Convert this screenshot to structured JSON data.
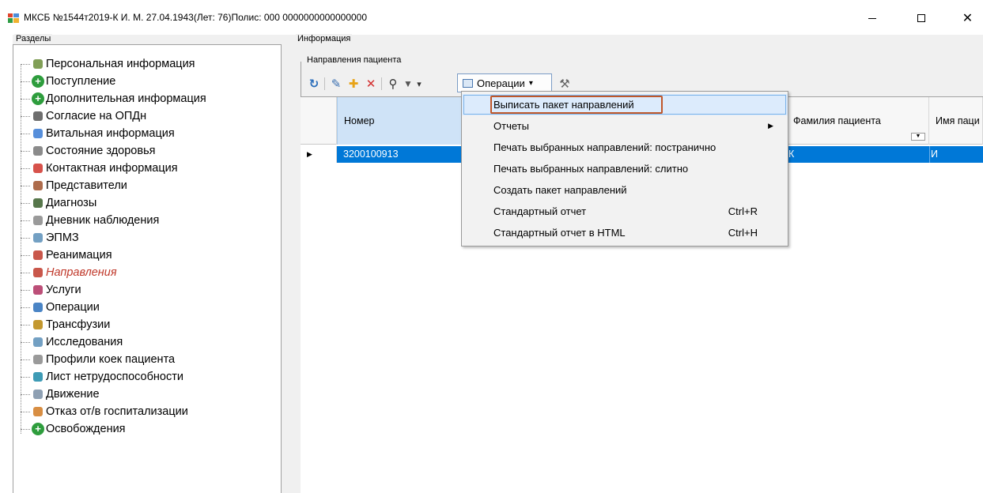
{
  "window": {
    "title": "МКСБ №1544т2019-К И. М.  27.04.1943(Лет: 76)Полис: 000 0000000000000000",
    "minimize_glyph": "—",
    "maximize_glyph": "☐",
    "close_glyph": "✕"
  },
  "left_panel": {
    "header": "Разделы",
    "items": [
      {
        "label": "Персональная информация",
        "icon": "person-icon",
        "color": "#6b8e3a"
      },
      {
        "label": "Поступление",
        "icon": "green-plus-circle-icon",
        "color": "#2e9d3d"
      },
      {
        "label": "Дополнительная информация",
        "icon": "green-plus-circle-icon",
        "color": "#2e9d3d"
      },
      {
        "label": "Согласие на ОПДн",
        "icon": "pen-icon",
        "color": "#555555"
      },
      {
        "label": "Витальная информация",
        "icon": "vital-chart-icon",
        "color": "#3a7bd5"
      },
      {
        "label": "Состояние здоровья",
        "icon": "health-icon",
        "color": "#777777"
      },
      {
        "label": "Контактная информация",
        "icon": "phone-icon",
        "color": "#d0342c"
      },
      {
        "label": "Представители",
        "icon": "representatives-icon",
        "color": "#a0522d"
      },
      {
        "label": "Диагнозы",
        "icon": "diagnosis-book-icon",
        "color": "#3a5f2b"
      },
      {
        "label": "Дневник наблюдения",
        "icon": "diary-icon",
        "color": "#888888"
      },
      {
        "label": "ЭПМЗ",
        "icon": "document-icon",
        "color": "#5b8fb9"
      },
      {
        "label": "Реанимация",
        "icon": "ecg-monitor-icon",
        "color": "#c0392b"
      },
      {
        "label": "Направления",
        "icon": "referral-icon",
        "color": "#c0392b"
      },
      {
        "label": "Услуги",
        "icon": "services-icon",
        "color": "#b03060"
      },
      {
        "label": "Операции",
        "icon": "surgery-icon",
        "color": "#2a6ebb"
      },
      {
        "label": "Трансфузии",
        "icon": "transfusion-icon",
        "color": "#b8860b"
      },
      {
        "label": "Исследования",
        "icon": "research-icon",
        "color": "#5b8fb9"
      },
      {
        "label": "Профили коек пациента",
        "icon": "bed-profile-icon",
        "color": "#888888"
      },
      {
        "label": "Лист нетрудоспособности",
        "icon": "sick-leave-icon",
        "color": "#1c8aa8"
      },
      {
        "label": "Движение",
        "icon": "movement-icon",
        "color": "#7a8fa6"
      },
      {
        "label": "Отказ от/в госпитализации",
        "icon": "refusal-icon",
        "color": "#d17a22"
      },
      {
        "label": "Освобождения",
        "icon": "green-plus-circle-icon",
        "color": "#2e9d3d"
      }
    ],
    "selected_label": "Направления"
  },
  "right_panel": {
    "header": "Информация",
    "subheader": "Направления пациента",
    "toolbar": {
      "refresh_glyph": "↻",
      "edit_glyph": "✎",
      "add_glyph": "✚",
      "delete_glyph": "✕",
      "find_glyph": "⚲",
      "filter_glyph": "▼",
      "dropdown_glyph": "▾",
      "operations_label": "Операции",
      "tools_glyph": "⚒"
    },
    "grid": {
      "columns": [
        "Номер",
        "Фамилия пациента",
        "Имя паци"
      ],
      "rows": [
        {
          "nomer": "3200100913",
          "familiya": "К",
          "imya": "И"
        }
      ],
      "row_marker": "▶",
      "filter_glyph": "▼"
    },
    "menu": {
      "items": [
        {
          "label": "Выписать пакет направлений",
          "shortcut": ""
        },
        {
          "label": "Отчеты",
          "shortcut": "",
          "submenu_glyph": "▶"
        },
        {
          "label": "Печать выбранных направлений: постранично",
          "shortcut": ""
        },
        {
          "label": "Печать выбранных направлений: слитно",
          "shortcut": ""
        },
        {
          "label": "Создать пакет направлений",
          "shortcut": ""
        },
        {
          "label": "Стандартный отчет",
          "shortcut": "Ctrl+R"
        },
        {
          "label": "Стандартный отчет в HTML",
          "shortcut": "Ctrl+H"
        }
      ]
    }
  },
  "colors": {
    "selection_blue": "#0078d7",
    "highlight_border": "#c0572a",
    "selected_tree_text": "#c0392b"
  }
}
